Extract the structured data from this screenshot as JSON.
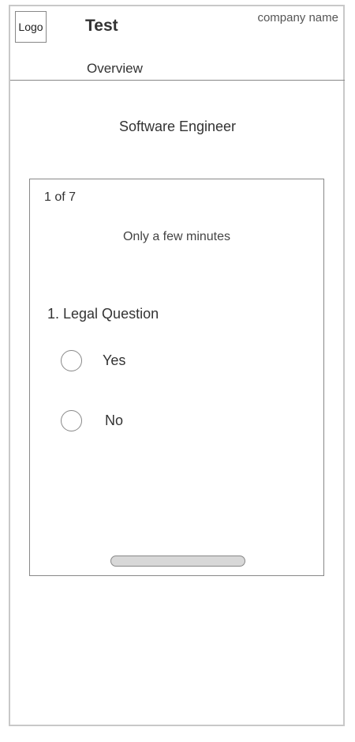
{
  "header": {
    "logo_text": "Logo",
    "app_title": "Test",
    "company_name": "company name",
    "tab_label": "Overview"
  },
  "main": {
    "job_title": "Software Engineer"
  },
  "card": {
    "progress": "1 of 7",
    "time_hint": "Only a few minutes",
    "question": "1. Legal Question",
    "options": [
      {
        "label": "Yes"
      },
      {
        "label": "No"
      }
    ]
  }
}
